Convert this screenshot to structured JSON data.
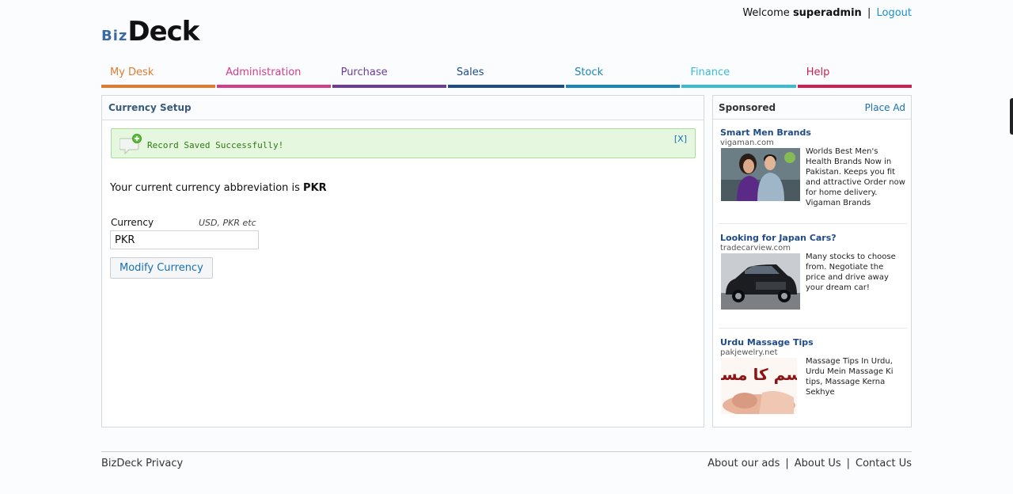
{
  "header": {
    "welcome": "Welcome",
    "user": "superadmin",
    "separator": "|",
    "logout": "Logout",
    "logo_biz": "Biz",
    "logo_deck": "Deck"
  },
  "nav": [
    {
      "label": "My Desk",
      "color": "#e07b2e"
    },
    {
      "label": "Administration",
      "color": "#d33d8e"
    },
    {
      "label": "Purchase",
      "color": "#6a3d96"
    },
    {
      "label": "Sales",
      "color": "#1f4c86"
    },
    {
      "label": "Stock",
      "color": "#1a86b8"
    },
    {
      "label": "Finance",
      "color": "#3bbcd3"
    },
    {
      "label": "Help",
      "color": "#cf1f4f"
    }
  ],
  "main": {
    "title": "Currency Setup",
    "alert": {
      "message": "Record Saved Successfully!",
      "close": "[X]"
    },
    "abbr_text": "Your current currency abbreviation is",
    "abbr_value": "PKR",
    "field_label": "Currency",
    "field_hint": "USD, PKR etc",
    "field_value": "PKR",
    "button": "Modify Currency"
  },
  "sponsored": {
    "title": "Sponsored",
    "place_ad": "Place Ad",
    "ads": [
      {
        "title": "Smart Men Brands",
        "url": "vigaman.com",
        "desc": "Worlds Best Men's Health Brands Now in Pakistan. Keeps you fit and attractive Order now for home delivery. Vigaman Brands",
        "image": "couple-photo"
      },
      {
        "title": "Looking for Japan Cars?",
        "url": "tradecarview.com",
        "desc": "Many stocks to choose from. Negotiate the price and drive away your dream car!",
        "image": "car-photo"
      },
      {
        "title": "Urdu Massage Tips",
        "url": "pakjewelry.net",
        "desc": "Massage Tips In Urdu, Urdu Mein Massage Ki tips, Massage Kerna Sekhye",
        "image": "massage-photo",
        "image_text": "جسم کا مساج"
      }
    ]
  },
  "footer": {
    "left": "BizDeck Privacy",
    "links": [
      "About our ads",
      "About Us",
      "Contact Us"
    ],
    "separator": "|"
  }
}
